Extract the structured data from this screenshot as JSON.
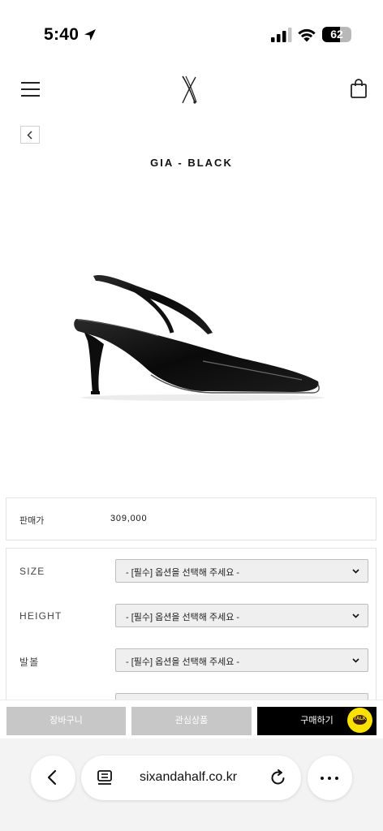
{
  "status": {
    "time": "5:40",
    "battery": "62",
    "battery_level": 0.62
  },
  "product": {
    "title": "GIA - BLACK"
  },
  "price": {
    "label": "판매가",
    "value": "309,000"
  },
  "options": [
    {
      "label": "SIZE",
      "placeholder": "- [필수] 옵션을 선택해 주세요 -"
    },
    {
      "label": "HEIGHT",
      "placeholder": "- [필수] 옵션을 선택해 주세요 -"
    },
    {
      "label": "발볼",
      "placeholder": "- [필수] 옵션을 선택해 주세요 -"
    }
  ],
  "actions": {
    "cart": "장바구니",
    "wish": "관심상품",
    "buy": "구매하기",
    "talk": "TALK"
  },
  "browser": {
    "url": "sixandahalf.co.kr"
  },
  "colors": {
    "accent": "#000000",
    "disabled_button": "#c7c7c7",
    "talk_badge": "#fae100"
  },
  "icons": [
    "location-arrow-icon",
    "signal-icon",
    "wifi-icon",
    "battery-icon",
    "hamburger-menu-icon",
    "brand-logo-icon",
    "shopping-bag-icon",
    "chevron-left-icon",
    "chevron-down-icon",
    "kakao-talk-icon",
    "tabs-icon",
    "reload-icon",
    "more-icon"
  ]
}
